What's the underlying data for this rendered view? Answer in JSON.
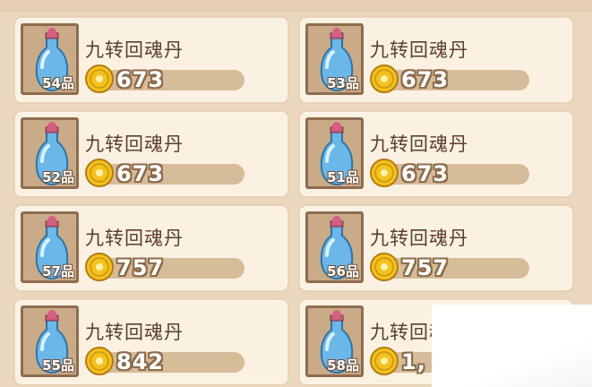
{
  "items": [
    {
      "name": "九转回魂丹",
      "grade": "54品",
      "price": "673",
      "icon": "potion-vase-icon"
    },
    {
      "name": "九转回魂丹",
      "grade": "53品",
      "price": "673",
      "icon": "potion-vase-icon"
    },
    {
      "name": "九转回魂丹",
      "grade": "52品",
      "price": "673",
      "icon": "potion-vase-icon"
    },
    {
      "name": "九转回魂丹",
      "grade": "51品",
      "price": "673",
      "icon": "potion-vase-icon"
    },
    {
      "name": "九转回魂丹",
      "grade": "57品",
      "price": "757",
      "icon": "potion-vase-icon"
    },
    {
      "name": "九转回魂丹",
      "grade": "56品",
      "price": "757",
      "icon": "potion-vase-icon"
    },
    {
      "name": "九转回魂丹",
      "grade": "55品",
      "price": "842",
      "icon": "potion-vase-icon"
    },
    {
      "name": "九转回魂丹",
      "grade": "58品",
      "price": "1,",
      "icon": "potion-vase-icon"
    }
  ],
  "currency_icon": "gold-coin-icon",
  "colors": {
    "card_bg": "#fbf1e2",
    "panel_bg": "#ead7bd",
    "thumb_bg": "#c9ab87",
    "thumb_border": "#8f6c4f",
    "name_text": "#5b3f2b",
    "price_bar": "#d7bc99",
    "coin": "#f3c21d"
  }
}
